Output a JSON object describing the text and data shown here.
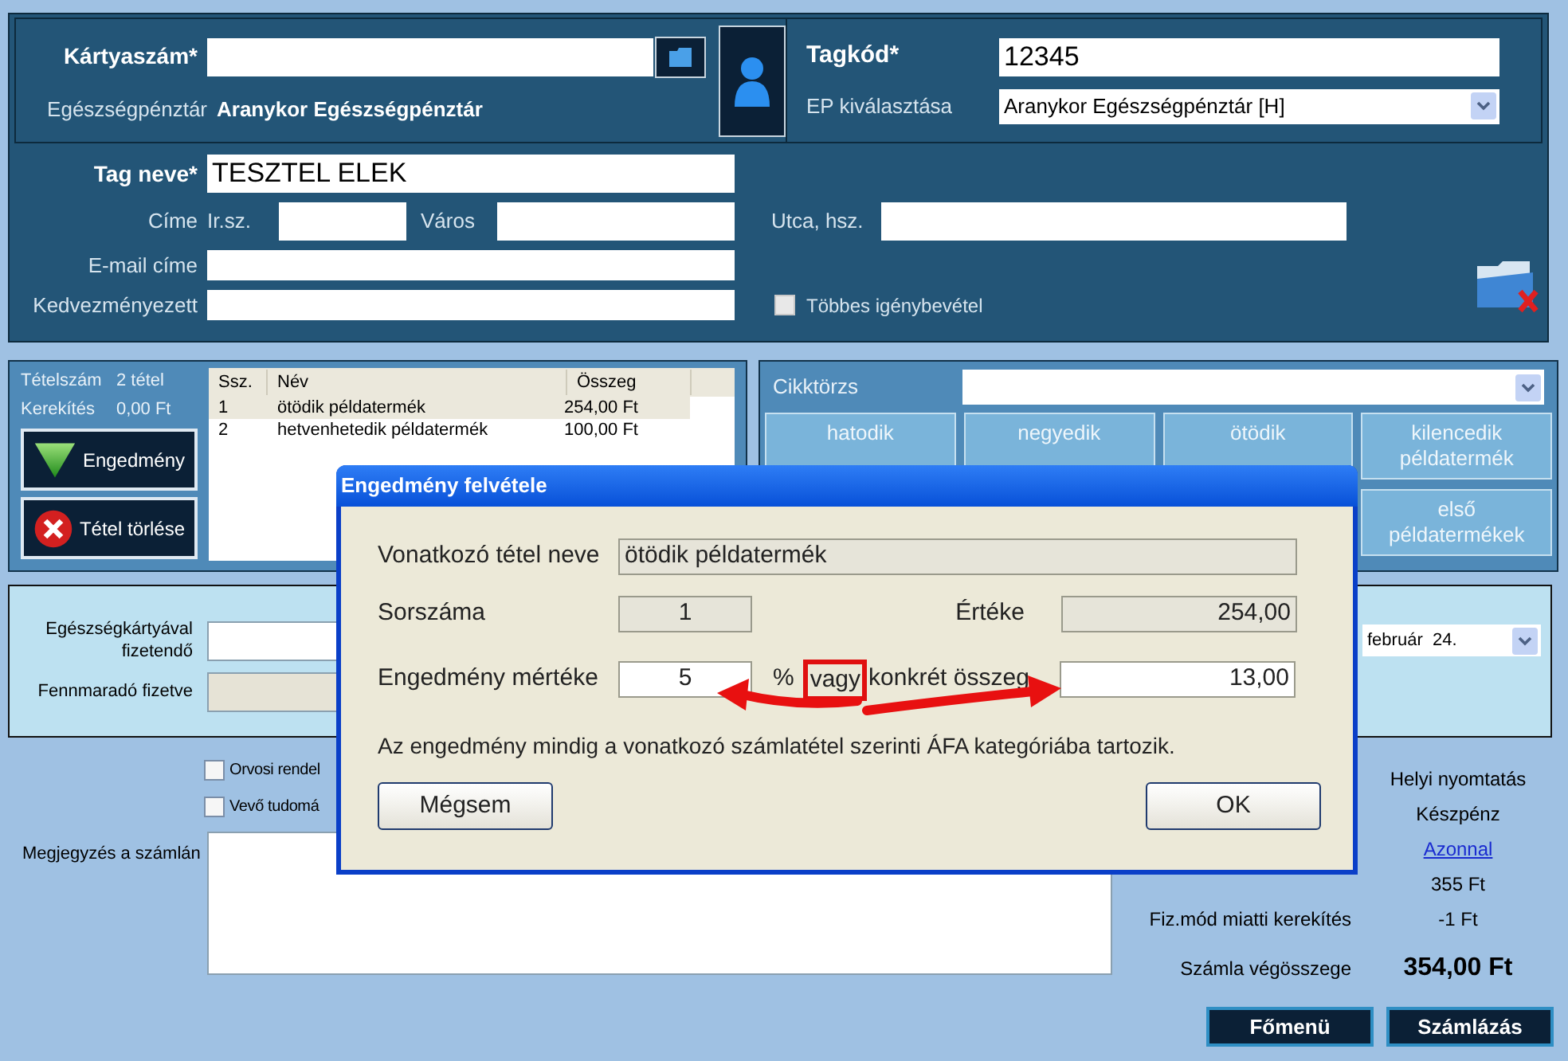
{
  "member_card": {
    "card_label": "Kártyaszám*",
    "fund_label": "Egészségpénztár",
    "fund_name": "Aranykor Egészségpénztár",
    "code_label": "Tagkód*",
    "code": "12345",
    "fund_select_label": "EP kiválasztása",
    "fund_select": "Aranykor Egészségpénztár [H]"
  },
  "member": {
    "name_label": "Tag neve*",
    "name": "TESZTEL ELEK",
    "address_label": "Címe",
    "zip_label": "Ir.sz.",
    "city_label": "Város",
    "street_label": "Utca, hsz.",
    "email_label": "E-mail címe",
    "beneficiary_label": "Kedvezményezett",
    "multiple_use": {
      "label": "Többes igénybevétel",
      "checked": false
    }
  },
  "items_panel": {
    "count_label": "Tételszám",
    "count": "2 tétel",
    "rounding_label": "Kerekítés",
    "rounding": "0,00 Ft",
    "buttons": [
      {
        "kind": "discount",
        "label": "Engedmény"
      },
      {
        "kind": "delete",
        "label": "Tétel törlése"
      }
    ],
    "table": {
      "columns": [
        "Ssz.",
        "Név",
        "Összeg"
      ],
      "rows": [
        {
          "cells": [
            "1",
            "ötödik példatermék",
            "254,00 Ft"
          ],
          "selected": true
        },
        {
          "cells": [
            "2",
            "hetvenhetedik példatermék",
            "100,00 Ft"
          ],
          "selected": false
        }
      ]
    }
  },
  "catalog": {
    "label": "Cikktörzs",
    "products": [
      "hatodik",
      "negyedik",
      "ötödik",
      "kilencedik példatermék",
      "első példatermékek"
    ]
  },
  "payment": {
    "card_pay_label": "Egészségkártyával fizetendő",
    "remaining_label": "Fennmaradó fizetve",
    "date": "február  24."
  },
  "options": [
    {
      "label": "Orvosi rendel",
      "checked": false
    },
    {
      "label": "Vevő tudomá",
      "checked": false
    }
  ],
  "note_label": "Megjegyzés a számlán",
  "summary": {
    "print": "Helyi nyomtatás",
    "method": "Készpénz",
    "deadline": "Azonnal",
    "payable": "355 Ft",
    "rounding_label": "Fiz.mód miatti kerekítés",
    "rounding": "-1 Ft",
    "total_label": "Számla végösszege",
    "total": "354,00 Ft"
  },
  "footer_buttons": [
    "Főmenü",
    "Számlázás"
  ],
  "dialog": {
    "title": "Engedmény felvétele",
    "item_name_label": "Vonatkozó tétel neve",
    "item_name": "ötödik példatermék",
    "index_label": "Sorszáma",
    "index": "1",
    "value_label": "Értéke",
    "value": "254,00",
    "discount_label": "Engedmény mértéke",
    "percent": "5",
    "percent_sign": "%",
    "or": "vagy",
    "amount_label": "konkrét összeg",
    "amount": "13,00",
    "note": "Az engedmény mindig a vonatkozó számlatétel szerinti ÁFA kategóriába tartozik.",
    "cancel": "Mégsem",
    "ok": "OK"
  }
}
